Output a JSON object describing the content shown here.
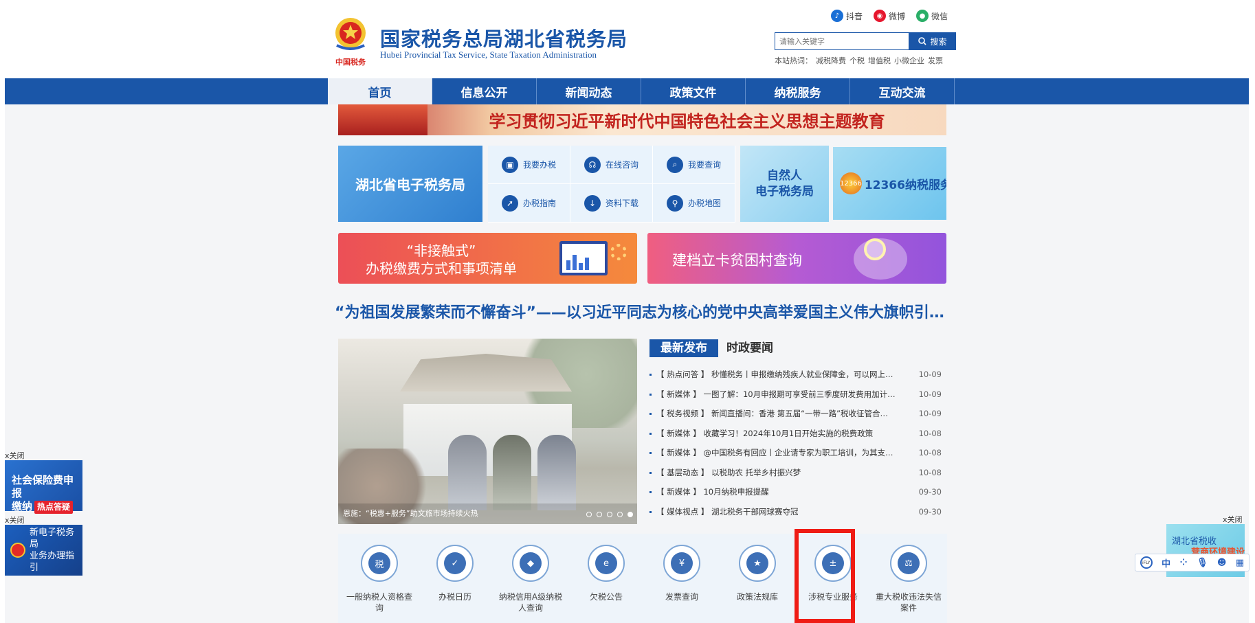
{
  "header": {
    "title": "国家税务总局湖北省税务局",
    "subtitle": "Hubei Provincial Tax Service, State Taxation Administration",
    "logo_text": "中国税务",
    "social": [
      {
        "label": "抖音",
        "icon": "douyin-icon",
        "color": "#1a6fd6"
      },
      {
        "label": "微博",
        "icon": "weibo-icon",
        "color": "#e6162d"
      },
      {
        "label": "微信",
        "icon": "wechat-icon",
        "color": "#2aae67"
      }
    ],
    "search_placeholder": "请输入关键字",
    "search_button": "搜索",
    "hot_label": "本站热词：",
    "hot_words": [
      "减税降费",
      "个税",
      "增值税",
      "小微企业",
      "发票"
    ]
  },
  "nav": [
    "首页",
    "信息公开",
    "新闻动态",
    "政策文件",
    "纳税服务",
    "互动交流"
  ],
  "banner_theme": "学习贯彻习近平新时代中国特色社会主义思想主题教育",
  "etax_label": "湖北省电子税务局",
  "quick_links": [
    {
      "label": "我要办税",
      "icon": "tax-filing-icon"
    },
    {
      "label": "在线咨询",
      "icon": "headset-icon"
    },
    {
      "label": "我要查询",
      "icon": "query-icon"
    },
    {
      "label": "办税指南",
      "icon": "compass-icon"
    },
    {
      "label": "资料下载",
      "icon": "download-icon"
    },
    {
      "label": "办税地图",
      "icon": "map-pin-icon"
    }
  ],
  "natural_person": {
    "line1": "自然人",
    "line2": "电子税务局"
  },
  "hotline": {
    "badge": "12366",
    "label": "12366纳税服务平台"
  },
  "promo_orange": {
    "line1": "“非接触式”",
    "line2": "办税缴费方式和事项清单"
  },
  "promo_purple": "建档立卡贫困村查询",
  "headline": "“为祖国发展繁荣而不懈奋斗”——以习近平同志为核心的党中央高举爱国主义伟大旗帜引领强…",
  "photo_caption": "恩施：“税惠+服务”助文旅市场持续火热",
  "news_tabs": [
    "最新发布",
    "时政要闻"
  ],
  "news": [
    {
      "cat": "热点问答",
      "title": "秒懂税务丨申报缴纳残疾人就业保障金，可以网上…",
      "date": "10-09"
    },
    {
      "cat": "新媒体",
      "title": "一图了解：10月申报期可享受前三季度研发费用加计…",
      "date": "10-09"
    },
    {
      "cat": "税务视频",
      "title": "新闻直播间：香港 第五届“一带一路”税收征管合…",
      "date": "10-09"
    },
    {
      "cat": "新媒体",
      "title": "收藏学习！2024年10月1日开始实施的税费政策",
      "date": "10-08"
    },
    {
      "cat": "新媒体",
      "title": "@中国税务有回应丨企业请专家为职工培训，为其支…",
      "date": "10-08"
    },
    {
      "cat": "基层动态",
      "title": "以税助农 托举乡村振兴梦",
      "date": "10-08"
    },
    {
      "cat": "新媒体",
      "title": "10月纳税申报提醒",
      "date": "09-30"
    },
    {
      "cat": "媒体视点",
      "title": "湖北税务干部网球赛夺冠",
      "date": "09-30"
    }
  ],
  "services": [
    {
      "label": "一般纳税人资格查询",
      "icon": "taxpayer-qualification-icon",
      "glyph": "税"
    },
    {
      "label": "办税日历",
      "icon": "calendar-icon",
      "glyph": "✓"
    },
    {
      "label": "纳税信用A级纳税人查询",
      "icon": "credit-diamond-icon",
      "glyph": "◆"
    },
    {
      "label": "欠税公告",
      "icon": "monitor-icon",
      "glyph": "e"
    },
    {
      "label": "发票查询",
      "icon": "invoice-icon",
      "glyph": "¥"
    },
    {
      "label": "政策法规库",
      "icon": "law-book-icon",
      "glyph": "★"
    },
    {
      "label": "涉税专业服务",
      "icon": "calculator-icon",
      "glyph": "±"
    },
    {
      "label": "重大税收违法失信案件",
      "icon": "case-file-icon",
      "glyph": "⚖"
    }
  ],
  "floats": {
    "close": "x关闭",
    "social_insurance": {
      "line1": "社会保险费申报",
      "line2": "缴纳",
      "tag": "热点答疑"
    },
    "e_tax_guide": {
      "line1": "新电子税务局",
      "line2": "业务办理指引"
    },
    "business_env": {
      "line1": "湖北省税收",
      "line2": "营商环境建设"
    }
  },
  "accessibility": {
    "lang": "中",
    "brand": "iFLY"
  }
}
